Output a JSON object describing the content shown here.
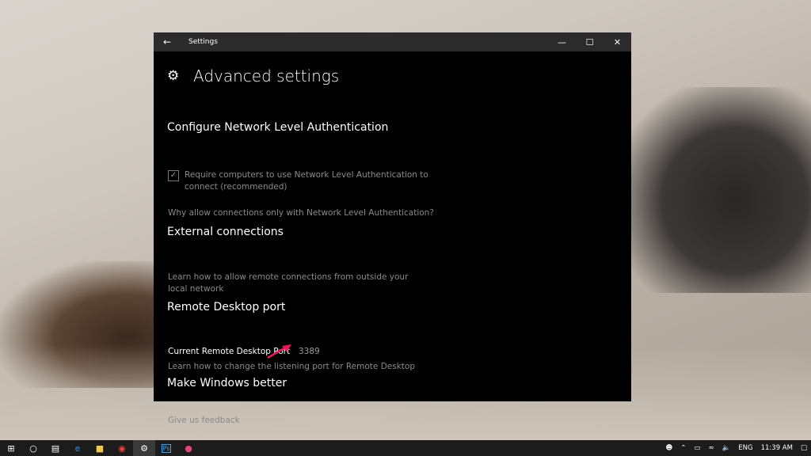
{
  "window": {
    "title": "Settings"
  },
  "page": {
    "title": "Advanced settings"
  },
  "nla": {
    "heading": "Configure Network Level Authentication",
    "checkbox_label": "Require computers to use Network Level Authentication to connect (recommended)",
    "checkbox_checked": true,
    "link": "Why allow connections only with Network Level Authentication?"
  },
  "external": {
    "heading": "External connections",
    "link": "Learn how to allow remote connections from outside your local network"
  },
  "port": {
    "heading": "Remote Desktop port",
    "label": "Current Remote Desktop Port",
    "value": "3389",
    "link": "Learn how to change the listening port for Remote Desktop"
  },
  "feedback": {
    "heading": "Make Windows better",
    "link": "Give us feedback"
  },
  "taskbar": {
    "language": "ENG",
    "time": "11:39 AM"
  },
  "colors": {
    "window_bg": "#000000",
    "titlebar_bg": "#2b2b2b",
    "muted_text": "#8a8a8a",
    "annotation_arrow": "#e8185a"
  }
}
